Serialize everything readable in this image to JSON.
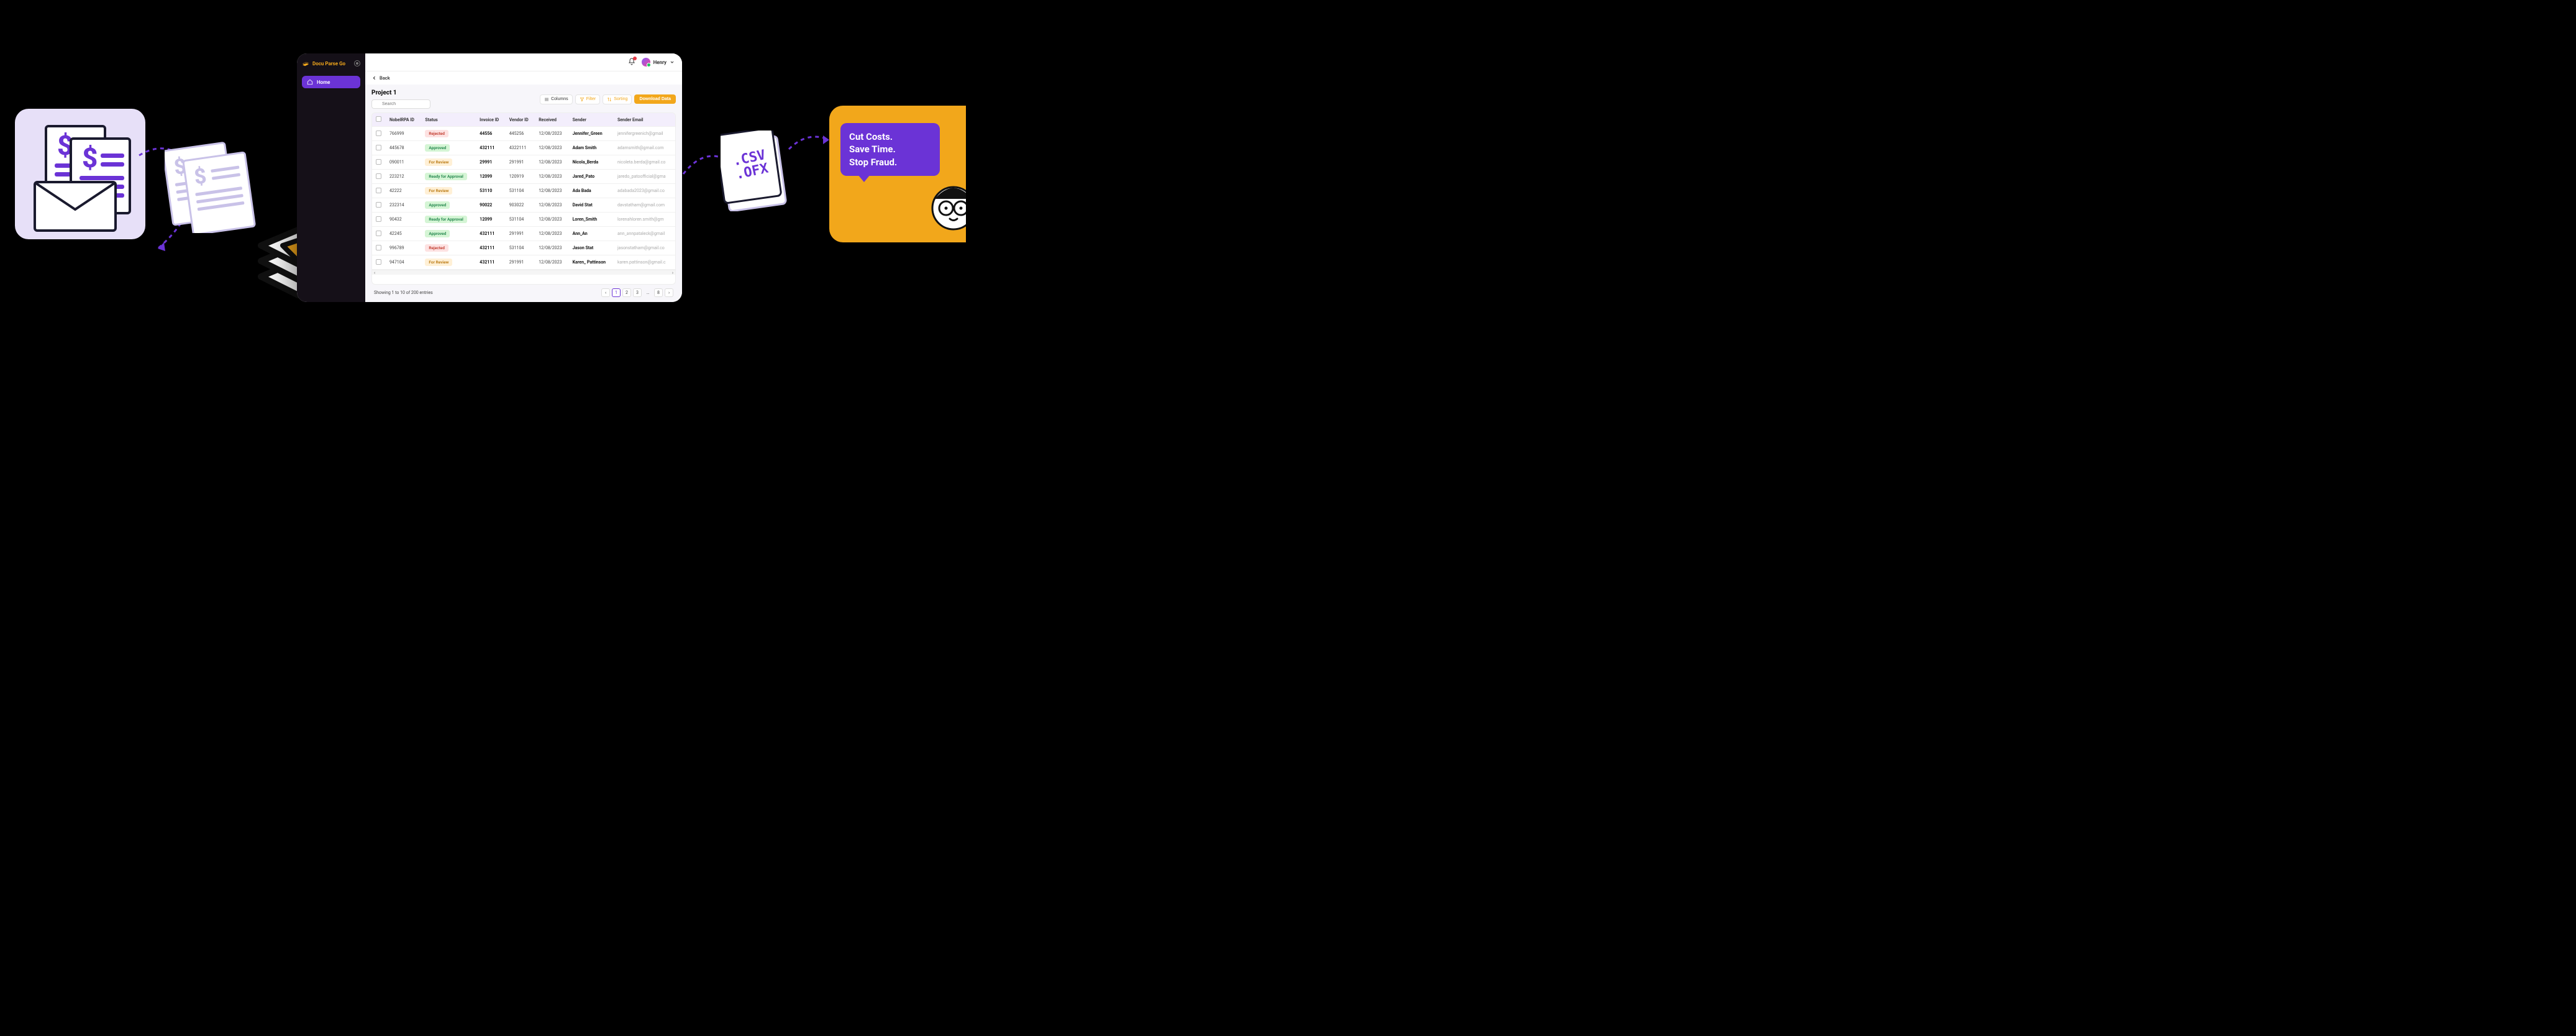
{
  "brand": {
    "name": "Docu Parse Go"
  },
  "sidebar": {
    "home": "Home"
  },
  "header": {
    "user_name": "Henry",
    "back_label": "Back"
  },
  "project": {
    "title": "Project 1",
    "search_placeholder": "Search"
  },
  "toolbar": {
    "columns": "Columns",
    "filter": "Filter",
    "sorting": "Sorting",
    "download": "Download Data"
  },
  "table": {
    "headers": {
      "id": "NobelRPA ID",
      "status": "Status",
      "invoice": "Invoice ID",
      "vendor": "Vendor ID",
      "received": "Received",
      "sender": "Sender",
      "email": "Sender Email"
    },
    "rows": [
      {
        "id": "766999",
        "status": "Rejected",
        "status_class": "rejected",
        "invoice": "44556",
        "vendor": "445256",
        "received": "12/08/2023",
        "sender": "Jennifer_Green",
        "email": "jennifergreenich@gmail"
      },
      {
        "id": "445678",
        "status": "Approved",
        "status_class": "approved",
        "invoice": "432111",
        "vendor": "4322111",
        "received": "12/08/2023",
        "sender": "Adam Smith",
        "email": "adamsmith@gmail.com"
      },
      {
        "id": "090011",
        "status": "For Review",
        "status_class": "review",
        "invoice": "29991",
        "vendor": "291991",
        "received": "12/08/2023",
        "sender": "Nicola_Berda",
        "email": "nicoleta.berda@gmail.co"
      },
      {
        "id": "223212",
        "status": "Ready for Approval",
        "status_class": "ready",
        "invoice": "12099",
        "vendor": "120919",
        "received": "12/08/2023",
        "sender": "Jared_Pato",
        "email": "jaredo_patoofficial@gma"
      },
      {
        "id": "42222",
        "status": "For Review",
        "status_class": "review",
        "invoice": "53110",
        "vendor": "531104",
        "received": "12/08/2023",
        "sender": "Ada Bada",
        "email": "adabada2023@gmail.co"
      },
      {
        "id": "232314",
        "status": "Approved",
        "status_class": "approved",
        "invoice": "90022",
        "vendor": "903022",
        "received": "12/08/2023",
        "sender": "David Stat",
        "email": "davstatham@gmail.com"
      },
      {
        "id": "90432",
        "status": "Ready for Approval",
        "status_class": "ready",
        "invoice": "12099",
        "vendor": "531104",
        "received": "12/08/2023",
        "sender": "Loren_Smith",
        "email": "lorenahloren.smith@gm"
      },
      {
        "id": "42245",
        "status": "Approved",
        "status_class": "approved",
        "invoice": "432111",
        "vendor": "291991",
        "received": "12/08/2023",
        "sender": "Ann_An",
        "email": "ann_annpataleck@gmail"
      },
      {
        "id": "996789",
        "status": "Rejected",
        "status_class": "rejected",
        "invoice": "432111",
        "vendor": "531104",
        "received": "12/08/2023",
        "sender": "Jason Stat",
        "email": "jasonstatham@gmail.co"
      },
      {
        "id": "947104",
        "status": "For Review",
        "status_class": "review",
        "invoice": "432111",
        "vendor": "291991",
        "received": "12/08/2023",
        "sender": "Karen_ Pattinson",
        "email": "karen.pattinson@gmail.c"
      }
    ]
  },
  "pagination": {
    "summary": "Showing 1 to 10 of 200 entries",
    "pages": [
      "1",
      "2",
      "3",
      "…",
      "8"
    ],
    "active": "1"
  },
  "export_formats": {
    "line1": ".CSV",
    "line2": ".OFX"
  },
  "promo": {
    "line1": "Cut Costs.",
    "line2": "Save Time.",
    "line3": "Stop Fraud."
  }
}
